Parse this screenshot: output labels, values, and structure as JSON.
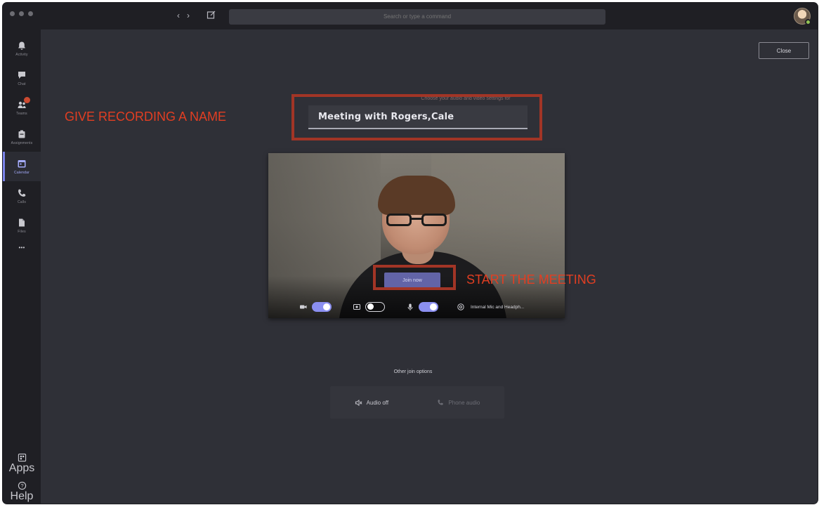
{
  "titlebar": {
    "back": "‹",
    "forward": "›",
    "search_placeholder": "Search or type a command"
  },
  "rail": {
    "items": [
      {
        "label": "Activity"
      },
      {
        "label": "Chat"
      },
      {
        "label": "Teams"
      },
      {
        "label": "Assignments"
      },
      {
        "label": "Calendar"
      },
      {
        "label": "Calls"
      },
      {
        "label": "Files"
      },
      {
        "label": "•••"
      }
    ],
    "bottom": [
      {
        "label": "Apps"
      },
      {
        "label": "Help"
      }
    ]
  },
  "main": {
    "close_label": "Close",
    "prompt": "Choose your audio and video settings for",
    "meeting_name": "Meeting with Rogers,Cale",
    "join_label": "Join now",
    "device_label": "Internal Mic and Headph...",
    "other_options_title": "Other join options",
    "audio_off_label": "Audio off",
    "phone_audio_label": "Phone audio"
  },
  "annotations": {
    "name_label": "GIVE RECORDING A NAME",
    "start_label": "START THE MEETING"
  },
  "colors": {
    "accent": "#6264a7",
    "annotation_text": "#e23e22",
    "annotation_box": "#a23526"
  }
}
